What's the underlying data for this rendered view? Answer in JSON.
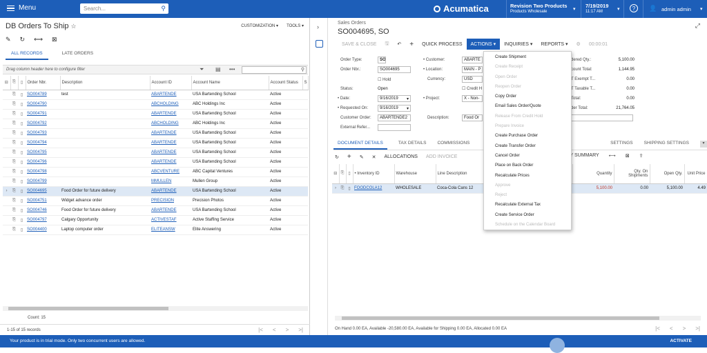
{
  "topbar": {
    "menu_label": "Menu",
    "search_placeholder": "Search...",
    "brand": "Acumatica",
    "company_line1": "Revision Two Products",
    "company_line2": "Products Wholesale",
    "date_line1": "7/19/2019",
    "date_line2": "11:17 AM",
    "help": "?",
    "user": "admin admin"
  },
  "left": {
    "title": "DB Orders To Ship",
    "customization": "CUSTOMIZATION",
    "tools": "TOOLS",
    "tabs": [
      "ALL RECORDS",
      "LATE ORDERS"
    ],
    "filter_placeholder": "Drag column header here to configure filter",
    "columns": [
      "Order Nbr.",
      "Description",
      "Account ID",
      "Account Name",
      "Account Status",
      "S"
    ],
    "rows": [
      {
        "order": "SO004789",
        "desc": "test",
        "acct": "ABARTENDE",
        "name": "USA Bartending School",
        "status": "Active"
      },
      {
        "order": "SO004790",
        "desc": "",
        "acct": "ABCHOLDING",
        "name": "ABC Holdings Inc",
        "status": "Active"
      },
      {
        "order": "SO004791",
        "desc": "",
        "acct": "ABARTENDE",
        "name": "USA Bartending School",
        "status": "Active"
      },
      {
        "order": "SO004792",
        "desc": "",
        "acct": "ABCHOLDING",
        "name": "ABC Holdings Inc",
        "status": "Active"
      },
      {
        "order": "SO004793",
        "desc": "",
        "acct": "ABARTENDE",
        "name": "USA Bartending School",
        "status": "Active"
      },
      {
        "order": "SO004794",
        "desc": "",
        "acct": "ABARTENDE",
        "name": "USA Bartending School",
        "status": "Active"
      },
      {
        "order": "SO004795",
        "desc": "",
        "acct": "ABARTENDE",
        "name": "USA Bartending School",
        "status": "Active"
      },
      {
        "order": "SO004796",
        "desc": "",
        "acct": "ABARTENDE",
        "name": "USA Bartending School",
        "status": "Active"
      },
      {
        "order": "SO004798",
        "desc": "",
        "acct": "ABCVENTURE",
        "name": "ABC Capital Ventures",
        "status": "Active"
      },
      {
        "order": "SO004799",
        "desc": "",
        "acct": "MMULLEN",
        "name": "Mullen Group",
        "status": "Active"
      },
      {
        "order": "SO004695",
        "desc": "Food Order for future delivery",
        "acct": "ABARTENDE",
        "name": "USA Bartending School",
        "status": "Active"
      },
      {
        "order": "SO004751",
        "desc": "Widget advance order",
        "acct": "PRECISION",
        "name": "Precision Photos",
        "status": "Active"
      },
      {
        "order": "SO004746",
        "desc": "Food Order for future delivery",
        "acct": "ABARTENDE",
        "name": "USA Bartending School",
        "status": "Active"
      },
      {
        "order": "SO004797",
        "desc": "Calgary Opportunity",
        "acct": "ACTIVESTAF",
        "name": "Active Staffing Service",
        "status": "Active"
      },
      {
        "order": "SO004400",
        "desc": "Laptop computer order",
        "acct": "ELITEANSW",
        "name": "Elite Answering",
        "status": "Active"
      }
    ],
    "count": "Count: 15",
    "records": "1-15 of 15 records"
  },
  "right": {
    "breadcrumb": "Sales Orders",
    "doc_title": "SO004695, SO",
    "toolbar": {
      "save_close": "SAVE & CLOSE",
      "quick_process": "QUICK PROCESS",
      "actions": "ACTIONS",
      "inquiries": "INQUIRIES",
      "reports": "REPORTS",
      "timer": "00:00:01"
    },
    "form": {
      "order_type_label": "Order Type:",
      "order_type": "SO",
      "order_nbr_label": "Order Nbr.:",
      "order_nbr": "SO004695",
      "hold_label": "Hold",
      "status_label": "Status:",
      "status": "Open",
      "date_label": "Date:",
      "date": "9/16/2019",
      "requested_label": "Requested On:",
      "requested": "9/16/2019",
      "cust_order_label": "Customer Order:",
      "cust_order": "ABARTENDE2",
      "ext_ref_label": "External Refer...",
      "customer_label": "Customer:",
      "customer": "ABARTE",
      "location_label": "Location:",
      "location": "MAIN - P",
      "currency_label": "Currency:",
      "currency": "USD",
      "credit_label": "Credit H",
      "project_label": "Project:",
      "project": "X - Non-",
      "description_label": "Description:",
      "description": "Food Or",
      "ordered_qty_label": "dered Qty.:",
      "ordered_qty": "5,100.00",
      "discount_label": "count Total:",
      "discount": "1,144.95",
      "exempt_label": "T Exempt T...",
      "exempt": "0.00",
      "taxable_label": "T Taxable T...",
      "taxable": "0.00",
      "tax_total_label": "Total:",
      "tax_total": "0.00",
      "order_total_label": "der Total:",
      "order_total": "21,764.05"
    },
    "tabs": [
      "DOCUMENT DETAILS",
      "TAX DETAILS",
      "COMMISSIONS",
      "SETTINGS",
      "SHIPPING SETTINGS"
    ],
    "detail_toolbar": {
      "allocations": "ALLOCATIONS",
      "add_invoice": "ADD INVOICE",
      "history_summary": "TORY SUMMARY"
    },
    "columns": [
      "Inventory ID",
      "Warehouse",
      "Line Description",
      "Quantity",
      "Qty. On Shipments",
      "Open Qty.",
      "Unit Price"
    ],
    "line": {
      "inventory": "FOODCOLA12",
      "warehouse": "WHOLESALE",
      "desc": "Coca-Cola Cans 12",
      "qty": "5,100.00",
      "qty_ship": "0.00",
      "open_qty": "5,100.00",
      "price": "4.49"
    },
    "onhand": "On Hand 0.00 EA, Available -20,580.00 EA, Available for Shipping 0.00 EA, Allocated 0.00 EA"
  },
  "actions_menu": [
    {
      "label": "Create Shipment",
      "enabled": true
    },
    {
      "label": "Create Receipt",
      "enabled": false
    },
    {
      "label": "Open Order",
      "enabled": false
    },
    {
      "label": "Reopen Order",
      "enabled": false
    },
    {
      "label": "Copy Order",
      "enabled": true
    },
    {
      "label": "Email Sales Order/Quote",
      "enabled": true
    },
    {
      "label": "Release From Credit Hold",
      "enabled": false
    },
    {
      "label": "Prepare Invoice",
      "enabled": false
    },
    {
      "label": "Create Purchase Order",
      "enabled": true
    },
    {
      "label": "Create Transfer Order",
      "enabled": true
    },
    {
      "label": "Cancel Order",
      "enabled": true
    },
    {
      "label": "Place on Back Order",
      "enabled": true
    },
    {
      "label": "Recalculate Prices",
      "enabled": true
    },
    {
      "label": "Approve",
      "enabled": false
    },
    {
      "label": "Reject",
      "enabled": false
    },
    {
      "label": "Recalculate External Tax",
      "enabled": true
    },
    {
      "label": "Create Service Order",
      "enabled": true
    },
    {
      "label": "Schedule on the Calendar Board",
      "enabled": false
    }
  ],
  "footer": {
    "message": "Your product is in trial mode. Only two concurrent users are allowed.",
    "activate": "ACTIVATE"
  },
  "colors": {
    "brand": "#1d5eb8",
    "selected_row": "#dde8f5",
    "negative": "#c0392b"
  }
}
